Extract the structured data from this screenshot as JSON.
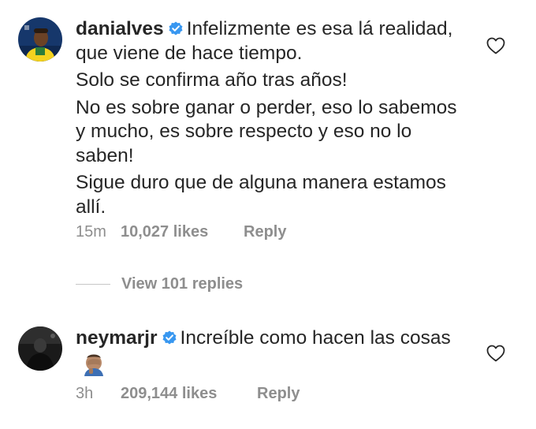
{
  "comments": [
    {
      "username": "danialves",
      "paragraphs": [
        "Infelizmente es esa lá realidad, que viene de hace tiempo.",
        "Solo se confirma año tras años!",
        "No es sobre ganar o perder, eso lo sabemos y mucho, es sobre respecto y eso no lo saben!",
        "Sigue duro que de alguna manera estamos allí."
      ],
      "time": "15m",
      "likes": "10,027 likes",
      "reply_label": "Reply",
      "avatar_icon": "soccer-player-yellow-jersey-avatar"
    },
    {
      "username": "neymarjr",
      "paragraphs": [
        "Increíble como hacen las cosas"
      ],
      "emoji": "facepalm-emoji",
      "time": "3h",
      "likes": "209,144 likes",
      "reply_label": "Reply",
      "avatar_icon": "dark-photo-avatar"
    }
  ],
  "view_replies": "View 101 replies",
  "colors": {
    "text": "#262626",
    "secondary": "#8e8e8e",
    "verified": "#3897f0"
  },
  "icons": {
    "verified": "verified-badge-icon",
    "like": "heart-outline-icon"
  }
}
